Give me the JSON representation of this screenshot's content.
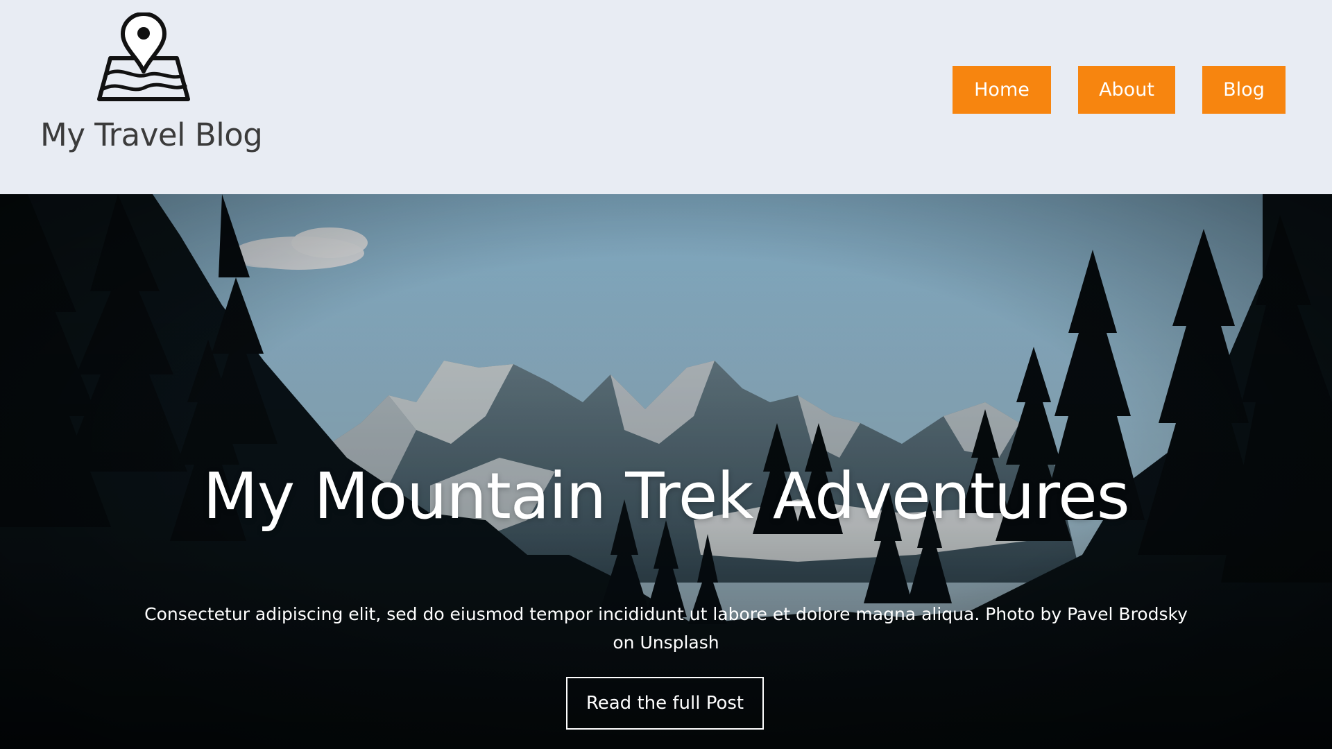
{
  "header": {
    "brand_name": "My Travel Blog",
    "logo_icon": "map-pin-icon",
    "nav": [
      {
        "label": "Home"
      },
      {
        "label": "About"
      },
      {
        "label": "Blog"
      }
    ],
    "accent_color": "#f7850f",
    "background_color": "#e8ecf3"
  },
  "hero": {
    "title": "My Mountain Trek Adventures",
    "description": "Consectetur adipiscing elit, sed do eiusmod tempor incididunt ut labore et dolore magna aliqua. Photo by Pavel Brodsky on Unsplash",
    "cta_label": "Read the full Post",
    "image_subject": "snowy mountain range framed by dark pine trees"
  }
}
